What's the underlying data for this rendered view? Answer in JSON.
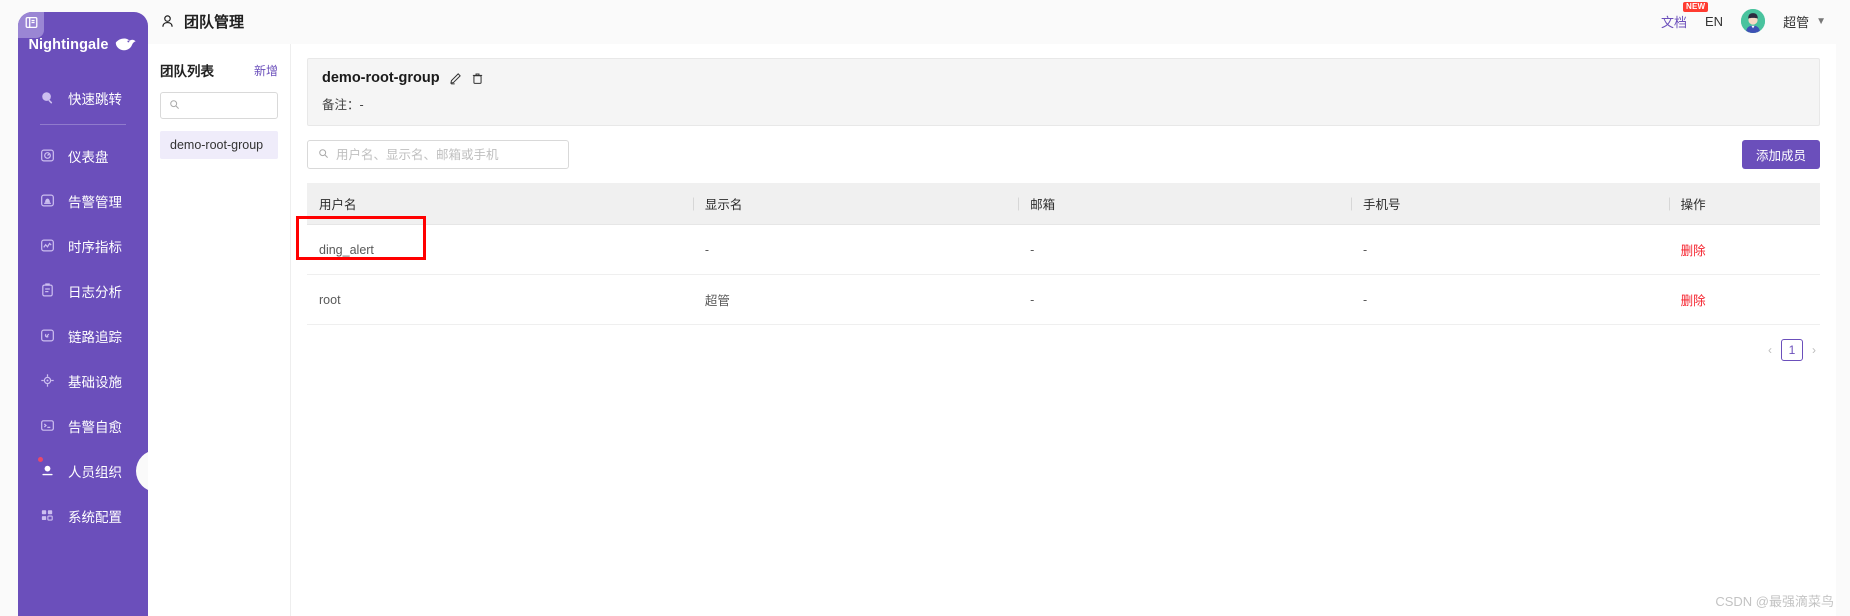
{
  "brand": {
    "name": "Nightingale",
    "mark_icon": "bird-logo-icon"
  },
  "sidebar": {
    "collapse_icon": "collapse-panel-icon",
    "accent": "#6b4fbb",
    "items": [
      {
        "label": "快速跳转",
        "icon": "search-icon",
        "active": false,
        "dot": false
      },
      {
        "label": "仪表盘",
        "icon": "dashboard-gauge-icon",
        "active": false,
        "dot": false
      },
      {
        "label": "告警管理",
        "icon": "alarm-bell-icon",
        "active": false,
        "dot": false
      },
      {
        "label": "时序指标",
        "icon": "metrics-line-icon",
        "active": false,
        "dot": false
      },
      {
        "label": "日志分析",
        "icon": "log-document-icon",
        "active": false,
        "dot": false
      },
      {
        "label": "链路追踪",
        "icon": "trace-link-icon",
        "active": false,
        "dot": false
      },
      {
        "label": "基础设施",
        "icon": "infrastructure-target-icon",
        "active": false,
        "dot": false
      },
      {
        "label": "告警自愈",
        "icon": "terminal-icon",
        "active": false,
        "dot": false
      },
      {
        "label": "人员组织",
        "icon": "user-org-icon",
        "active": true,
        "dot": true
      },
      {
        "label": "系统配置",
        "icon": "system-config-grid-icon",
        "active": false,
        "dot": false
      }
    ]
  },
  "topbar": {
    "title": "团队管理",
    "title_icon": "user-person-icon",
    "doc_label": "文档",
    "doc_badge": "NEW",
    "lang_label": "EN",
    "user_name": "超管",
    "caret_icon": "chevron-down-icon",
    "avatar_icon": "user-avatar"
  },
  "team_list": {
    "title": "团队列表",
    "add_label": "新增",
    "search_icon": "search-icon",
    "search_value": "",
    "search_placeholder": "",
    "items": [
      {
        "label": "demo-root-group",
        "selected": true
      }
    ]
  },
  "group": {
    "name": "demo-root-group",
    "edit_icon": "pencil-edit-icon",
    "delete_icon": "trash-delete-icon",
    "note_label": "备注：",
    "note_value": "-"
  },
  "toolbar": {
    "search_icon": "search-icon",
    "search_value": "",
    "search_placeholder": "用户名、显示名、邮箱或手机",
    "add_member_label": "添加成员",
    "primary_color": "#6b4fbb"
  },
  "table": {
    "columns": [
      "用户名",
      "显示名",
      "邮箱",
      "手机号",
      "操作"
    ],
    "rows": [
      {
        "username": "ding_alert",
        "display_name": "-",
        "email": "-",
        "phone": "-",
        "action": "删除",
        "highlighted": true
      },
      {
        "username": "root",
        "display_name": "超管",
        "email": "-",
        "phone": "-",
        "action": "删除",
        "highlighted": false
      }
    ],
    "action_color": "#f5222d"
  },
  "pagination": {
    "prev_icon": "chevron-left-icon",
    "next_icon": "chevron-right-icon",
    "current_page": "1"
  },
  "watermark": {
    "text": "CSDN @最强滴菜鸟"
  }
}
